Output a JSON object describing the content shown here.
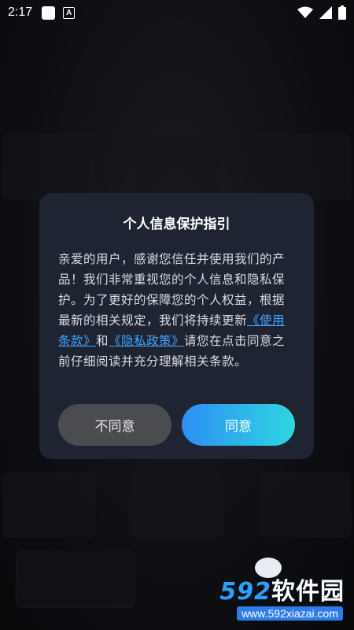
{
  "status_bar": {
    "time": "2:17",
    "a_badge": "A",
    "icons": [
      "wifi-icon",
      "signal-icon",
      "battery-icon"
    ]
  },
  "dialog": {
    "title": "个人信息保护指引",
    "body": {
      "text_before": "亲爱的用户，感谢您信任并使用我们的产品！我们非常重视您的个人信息和隐私保护。为了更好的保障您的个人权益，根据最新的相关规定，我们将持续更新",
      "link_terms": "《使用条款》",
      "text_and": "和",
      "link_privacy": "《隐私政策》",
      "text_after": "请您在点击同意之前仔细阅读并充分理解相关条款。"
    },
    "disagree_label": "不同意",
    "agree_label": "同意"
  },
  "watermark": {
    "logo_digits": "592",
    "logo_text": "软件园",
    "url": "www.592xiazai.com"
  },
  "colors": {
    "dialog_bg": "#1f2433",
    "link": "#3fa6ff",
    "agree_start": "#2d8ff5",
    "agree_end": "#2ed6e0",
    "disagree_bg": "#4b4c50"
  }
}
